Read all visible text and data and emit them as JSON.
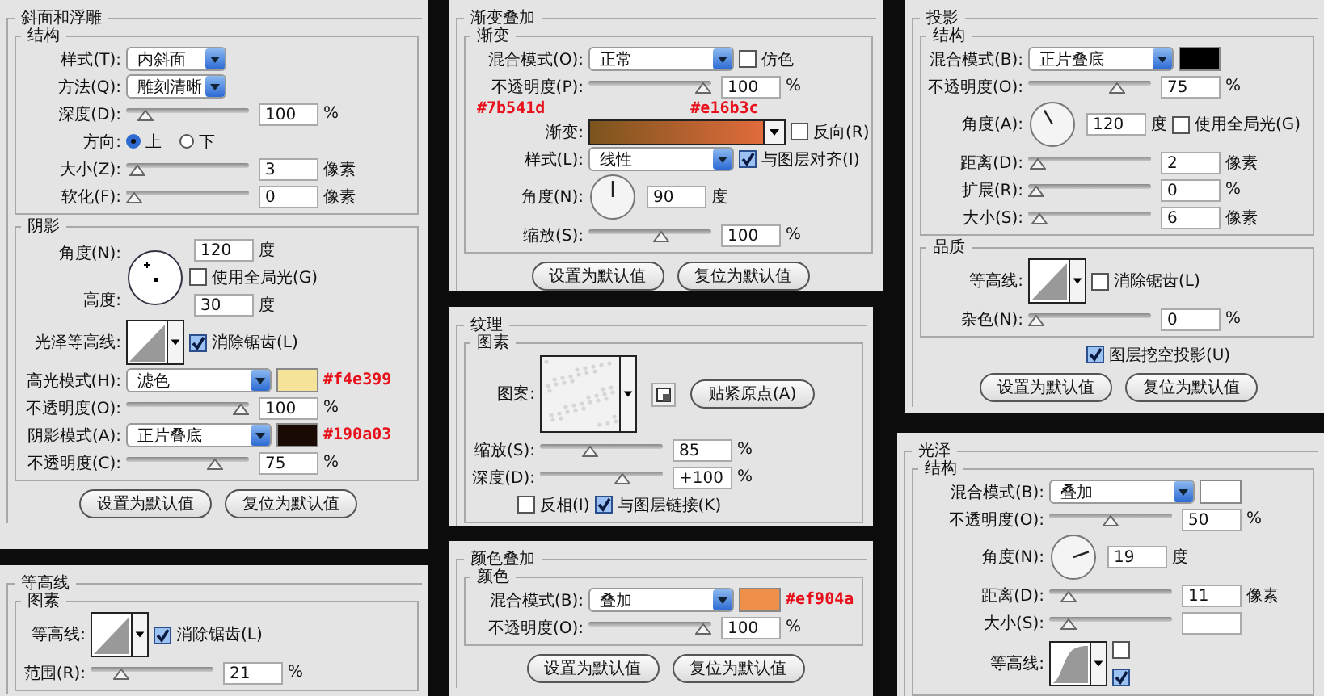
{
  "panels": [
    {
      "title": "斜面和浮雕",
      "groups": [
        {
          "title": "结构",
          "rows": [
            {
              "items": [
                {
                  "kind": "label",
                  "text": "样式(T):"
                },
                {
                  "kind": "select",
                  "value": "内斜面"
                }
              ]
            },
            {
              "items": [
                {
                  "kind": "label",
                  "text": "方法(Q):"
                },
                {
                  "kind": "select",
                  "value": "雕刻清晰"
                }
              ]
            },
            {
              "items": [
                {
                  "kind": "label",
                  "text": "深度(D):"
                },
                {
                  "kind": "slider",
                  "level": 0.1
                },
                {
                  "kind": "field",
                  "value": "100"
                },
                {
                  "kind": "unit",
                  "text": "%"
                }
              ]
            },
            {
              "items": [
                {
                  "kind": "label",
                  "text": "方向:"
                },
                {
                  "kind": "radio",
                  "label": "上",
                  "selected": true
                },
                {
                  "kind": "radio",
                  "label": "下",
                  "selected": false
                }
              ]
            },
            {
              "items": [
                {
                  "kind": "label",
                  "text": "大小(Z):"
                },
                {
                  "kind": "slider",
                  "level": 0.03
                },
                {
                  "kind": "field",
                  "value": "3"
                },
                {
                  "kind": "unit",
                  "text": "像素"
                }
              ]
            },
            {
              "items": [
                {
                  "kind": "label",
                  "text": "软化(F):"
                },
                {
                  "kind": "slider",
                  "level": 0
                },
                {
                  "kind": "field",
                  "value": "0"
                },
                {
                  "kind": "unit",
                  "text": "像素"
                }
              ]
            }
          ]
        },
        {
          "title": "阴影",
          "rows": [
            {
              "items": [
                {
                  "kind": "column",
                  "rows": [
                    {
                      "items": [
                        {
                          "kind": "label",
                          "text": "角度(N):"
                        }
                      ]
                    },
                    {
                      "items": [
                        {
                          "kind": "label",
                          "text": "高度:"
                        }
                      ]
                    }
                  ]
                },
                {
                  "kind": "globe"
                },
                {
                  "kind": "column",
                  "rows": [
                    {
                      "items": [
                        {
                          "kind": "field",
                          "value": "120"
                        },
                        {
                          "kind": "unit",
                          "text": "度"
                        }
                      ]
                    },
                    {
                      "items": [
                        {
                          "kind": "checkbox",
                          "label": "使用全局光(G)",
                          "checked": false
                        }
                      ]
                    },
                    {
                      "items": [
                        {
                          "kind": "field",
                          "value": "30"
                        },
                        {
                          "kind": "unit",
                          "text": "度"
                        }
                      ]
                    }
                  ]
                }
              ]
            },
            {
              "items": [
                {
                  "kind": "label",
                  "text": "光泽等高线:"
                },
                {
                  "kind": "linear-contour"
                },
                {
                  "kind": "checkbox",
                  "label": "消除锯齿(L)",
                  "checked": true
                }
              ]
            },
            {
              "items": [
                {
                  "kind": "label",
                  "text": "高光模式(H):"
                },
                {
                  "kind": "select",
                  "value": "滤色"
                },
                {
                  "kind": "swatch",
                  "color": "#f4e399"
                },
                {
                  "kind": "hex",
                  "text": "#f4e399"
                }
              ]
            },
            {
              "items": [
                {
                  "kind": "label",
                  "text": "不透明度(O):"
                },
                {
                  "kind": "slider",
                  "level": 1
                },
                {
                  "kind": "field",
                  "value": "100"
                },
                {
                  "kind": "unit",
                  "text": "%"
                }
              ]
            },
            {
              "items": [
                {
                  "kind": "label",
                  "text": "阴影模式(A):"
                },
                {
                  "kind": "select",
                  "value": "正片叠底"
                },
                {
                  "kind": "swatch",
                  "color": "#190a03"
                },
                {
                  "kind": "hex",
                  "text": "#190a03"
                }
              ]
            },
            {
              "items": [
                {
                  "kind": "label",
                  "text": "不透明度(C):"
                },
                {
                  "kind": "slider",
                  "level": 0.75
                },
                {
                  "kind": "field",
                  "value": "75"
                },
                {
                  "kind": "unit",
                  "text": "%"
                }
              ]
            }
          ]
        }
      ],
      "buttons": [
        "设置为默认值",
        "复位为默认值"
      ]
    },
    {
      "title": "等高线",
      "groups": [
        {
          "title": "图素",
          "rows": [
            {
              "items": [
                {
                  "kind": "label",
                  "text": "等高线:"
                },
                {
                  "kind": "linear-contour"
                },
                {
                  "kind": "checkbox",
                  "label": "消除锯齿(L)",
                  "checked": true
                }
              ]
            },
            {
              "items": [
                {
                  "kind": "label",
                  "text": "范围(R):"
                },
                {
                  "kind": "slider",
                  "level": 0.21
                },
                {
                  "kind": "field",
                  "value": "21"
                },
                {
                  "kind": "unit",
                  "text": "%"
                }
              ]
            }
          ]
        }
      ]
    },
    {
      "title": "渐变叠加",
      "groups": [
        {
          "title": "渐变",
          "rows": [
            {
              "items": [
                {
                  "kind": "label",
                  "text": "混合模式(O):"
                },
                {
                  "kind": "select",
                  "value": "正常"
                },
                {
                  "kind": "checkbox",
                  "label": "仿色",
                  "checked": false
                }
              ]
            },
            {
              "items": [
                {
                  "kind": "label",
                  "text": "不透明度(P):"
                },
                {
                  "kind": "slider",
                  "level": 1
                },
                {
                  "kind": "field",
                  "value": "100"
                },
                {
                  "kind": "unit",
                  "text": "%"
                }
              ]
            },
            {
              "items": [
                {
                  "kind": "hex",
                  "text": "#7b541d"
                },
                {
                  "kind": "hex",
                  "text": "#e16b3c"
                }
              ]
            },
            {
              "items": [
                {
                  "kind": "label",
                  "text": "渐变:"
                },
                {
                  "kind": "gradient"
                },
                {
                  "kind": "checkbox",
                  "label": "反向(R)",
                  "checked": false
                }
              ]
            },
            {
              "items": [
                {
                  "kind": "label",
                  "text": "样式(L):"
                },
                {
                  "kind": "select",
                  "value": "线性"
                },
                {
                  "kind": "checkbox",
                  "label": "与图层对齐(I)",
                  "checked": true
                }
              ]
            },
            {
              "items": [
                {
                  "kind": "label",
                  "text": "角度(N):"
                },
                {
                  "kind": "dial"
                },
                {
                  "kind": "field",
                  "value": "90"
                },
                {
                  "kind": "unit",
                  "text": "度"
                }
              ]
            },
            {
              "items": [
                {
                  "kind": "label",
                  "text": "缩放(S):"
                },
                {
                  "kind": "slider",
                  "level": 0.6
                },
                {
                  "kind": "field",
                  "value": "100"
                },
                {
                  "kind": "unit",
                  "text": "%"
                }
              ]
            }
          ]
        }
      ],
      "buttons": [
        "设置为默认值",
        "复位为默认值"
      ]
    },
    {
      "title": "纹理",
      "groups": [
        {
          "title": "图素",
          "rows": [
            {
              "items": [
                {
                  "kind": "label",
                  "text": "图案:"
                },
                {
                  "kind": "pattern"
                },
                {
                  "kind": "iconbutton"
                },
                {
                  "kind": "button",
                  "label": "贴紧原点(A)"
                }
              ]
            },
            {
              "items": [
                {
                  "kind": "label",
                  "text": "缩放(S):"
                },
                {
                  "kind": "slider",
                  "level": 0.4
                },
                {
                  "kind": "field",
                  "value": "85"
                },
                {
                  "kind": "unit",
                  "text": "%"
                }
              ]
            },
            {
              "items": [
                {
                  "kind": "label",
                  "text": "深度(D):"
                },
                {
                  "kind": "slider",
                  "level": 0.7
                },
                {
                  "kind": "field",
                  "value": "+100"
                },
                {
                  "kind": "unit",
                  "text": "%"
                }
              ]
            },
            {
              "items": [
                {
                  "kind": "checkbox",
                  "label": "反相(I)",
                  "checked": false
                },
                {
                  "kind": "checkbox",
                  "label": "与图层链接(K)",
                  "checked": true
                }
              ]
            }
          ]
        }
      ]
    },
    {
      "title": "颜色叠加",
      "groups": [
        {
          "title": "颜色",
          "rows": [
            {
              "items": [
                {
                  "kind": "label",
                  "text": "混合模式(B):"
                },
                {
                  "kind": "select",
                  "value": "叠加"
                },
                {
                  "kind": "swatch",
                  "color": "#ef904a"
                },
                {
                  "kind": "hex",
                  "text": "#ef904a"
                }
              ]
            },
            {
              "items": [
                {
                  "kind": "label",
                  "text": "不透明度(O):"
                },
                {
                  "kind": "slider",
                  "level": 1
                },
                {
                  "kind": "field",
                  "value": "100"
                },
                {
                  "kind": "unit",
                  "text": "%"
                }
              ]
            }
          ]
        }
      ],
      "buttons": [
        "设置为默认值",
        "复位为默认值"
      ]
    },
    {
      "title": "投影",
      "groups": [
        {
          "title": "结构",
          "rows": [
            {
              "items": [
                {
                  "kind": "label",
                  "text": "混合模式(B):"
                },
                {
                  "kind": "select",
                  "value": "正片叠底"
                },
                {
                  "kind": "swatch",
                  "color": "#000000"
                }
              ]
            },
            {
              "items": [
                {
                  "kind": "label",
                  "text": "不透明度(O):"
                },
                {
                  "kind": "slider",
                  "level": 0.75
                },
                {
                  "kind": "field",
                  "value": "75"
                },
                {
                  "kind": "unit",
                  "text": "%"
                }
              ]
            },
            {
              "items": [
                {
                  "kind": "label",
                  "text": "角度(A):"
                },
                {
                  "kind": "dial"
                },
                {
                  "kind": "field",
                  "value": "120"
                },
                {
                  "kind": "unit",
                  "text": "度"
                },
                {
                  "kind": "checkbox",
                  "label": "使用全局光(G)",
                  "checked": false
                }
              ]
            },
            {
              "items": [
                {
                  "kind": "label",
                  "text": "距离(D):"
                },
                {
                  "kind": "slider",
                  "level": 0.02
                },
                {
                  "kind": "field",
                  "value": "2"
                },
                {
                  "kind": "unit",
                  "text": "像素"
                }
              ]
            },
            {
              "items": [
                {
                  "kind": "label",
                  "text": "扩展(R):"
                },
                {
                  "kind": "slider",
                  "level": 0
                },
                {
                  "kind": "field",
                  "value": "0"
                },
                {
                  "kind": "unit",
                  "text": "%"
                }
              ]
            },
            {
              "items": [
                {
                  "kind": "label",
                  "text": "大小(S):"
                },
                {
                  "kind": "slider",
                  "level": 0.03
                },
                {
                  "kind": "field",
                  "value": "6"
                },
                {
                  "kind": "unit",
                  "text": "像素"
                }
              ]
            }
          ]
        },
        {
          "title": "品质",
          "rows": [
            {
              "items": [
                {
                  "kind": "label",
                  "text": "等高线:"
                },
                {
                  "kind": "linear-contour"
                },
                {
                  "kind": "checkbox",
                  "label": "消除锯齿(L)",
                  "checked": false
                }
              ]
            },
            {
              "items": [
                {
                  "kind": "label",
                  "text": "杂色(N):"
                },
                {
                  "kind": "slider",
                  "level": 0
                },
                {
                  "kind": "field",
                  "value": "0"
                },
                {
                  "kind": "unit",
                  "text": "%"
                }
              ]
            }
          ]
        }
      ],
      "after": [
        {
          "items": [
            {
              "kind": "checkbox",
              "label": "图层挖空投影(U)",
              "checked": true
            }
          ]
        }
      ],
      "buttons": [
        "设置为默认值",
        "复位为默认值"
      ]
    },
    {
      "title": "光泽",
      "groups": [
        {
          "title": "结构",
          "rows": [
            {
              "items": [
                {
                  "kind": "label",
                  "text": "混合模式(B):"
                },
                {
                  "kind": "select",
                  "value": "叠加"
                },
                {
                  "kind": "swatch",
                  "color": "#ffffff"
                }
              ]
            },
            {
              "items": [
                {
                  "kind": "label",
                  "text": "不透明度(O):"
                },
                {
                  "kind": "slider",
                  "level": 0.5
                },
                {
                  "kind": "field",
                  "value": "50"
                },
                {
                  "kind": "unit",
                  "text": "%"
                }
              ]
            },
            {
              "items": [
                {
                  "kind": "label",
                  "text": "角度(N):"
                },
                {
                  "kind": "dial"
                },
                {
                  "kind": "field",
                  "value": "19"
                },
                {
                  "kind": "unit",
                  "text": "度"
                }
              ]
            },
            {
              "items": [
                {
                  "kind": "label",
                  "text": "距离(D):"
                },
                {
                  "kind": "slider",
                  "level": 0.1
                },
                {
                  "kind": "field",
                  "value": "11"
                },
                {
                  "kind": "unit",
                  "text": "像素"
                }
              ]
            },
            {
              "items": [
                {
                  "kind": "label",
                  "text": "大小(S):"
                },
                {
                  "kind": "slider",
                  "level": 0.1
                },
                {
                  "kind": "field"
                }
              ]
            },
            {
              "items": [
                {
                  "kind": "label",
                  "text": "等高线:"
                },
                {
                  "kind": "rounded-contour"
                },
                {
                  "kind": "column",
                  "rows": [
                    {
                      "items": [
                        {
                          "kind": "checkbox",
                          "checked": false
                        }
                      ]
                    },
                    {
                      "items": [
                        {
                          "kind": "checkbox",
                          "checked": true
                        }
                      ]
                    }
                  ]
                }
              ]
            }
          ]
        }
      ]
    }
  ]
}
